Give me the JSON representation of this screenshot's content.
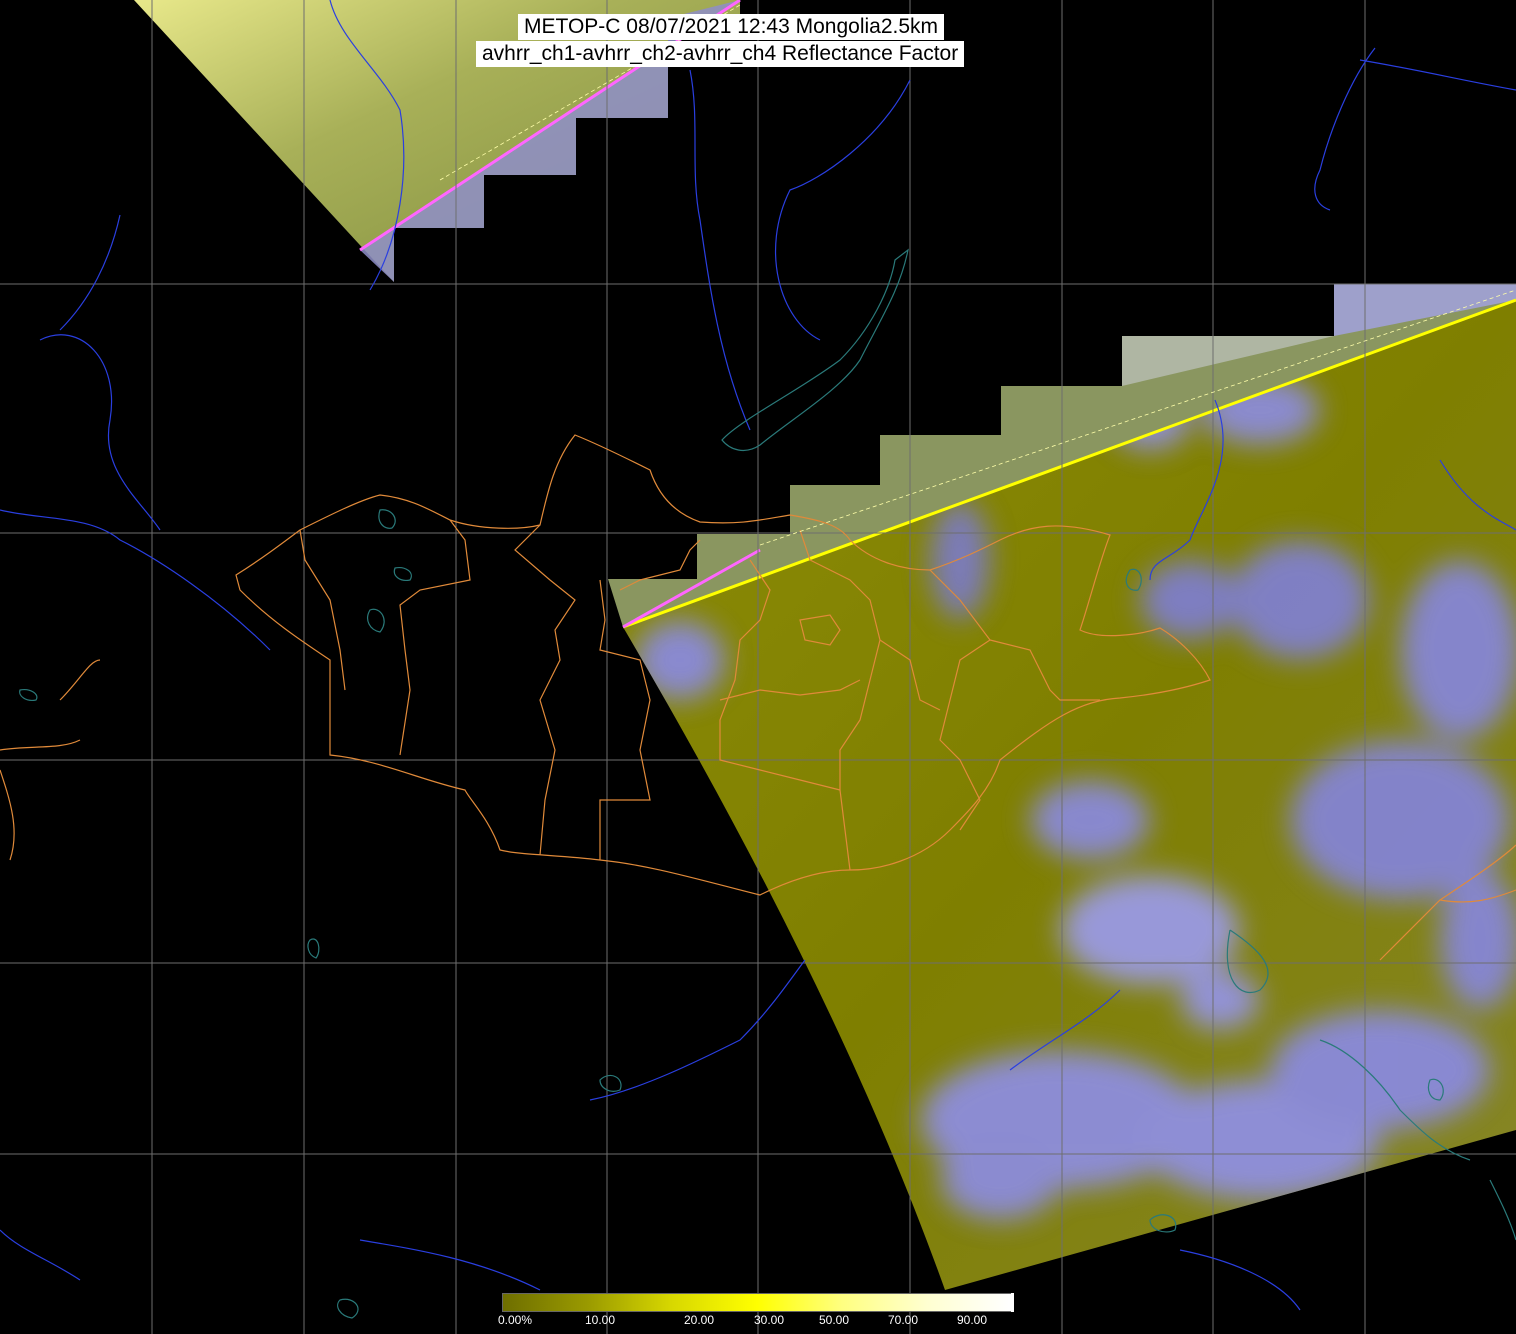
{
  "title": {
    "line1": "METOP-C 08/07/2021 12:43 Mongolia2.5km",
    "line2": "avhrr_ch1-avhrr_ch2-avhrr_ch4 Reflectance Factor"
  },
  "colorbar": {
    "ticks": [
      "0.00%",
      "10.00",
      "20.00",
      "30.00",
      "50.00",
      "70.00",
      "90.00"
    ],
    "colors": [
      "#6e6e00",
      "#9a9a00",
      "#d8d800",
      "#ffff00",
      "#ffff80",
      "#ffffd0",
      "#ffffff"
    ]
  },
  "colors": {
    "background": "#000000",
    "grid": "#6e6e6e",
    "rivers": "#2a3fe0",
    "coastlines_lakes": "#2a7a7a",
    "admin_borders": "#e08a3a",
    "clear_land": "#848400",
    "cloud": "#8a8ae8",
    "swath_edge_line": "#ffff00",
    "swath_edge_line_north": "#ff66ff"
  },
  "layers": [
    "lat-lon-grid",
    "rivers",
    "coastlines",
    "administrative-borders",
    "satellite-swath"
  ]
}
